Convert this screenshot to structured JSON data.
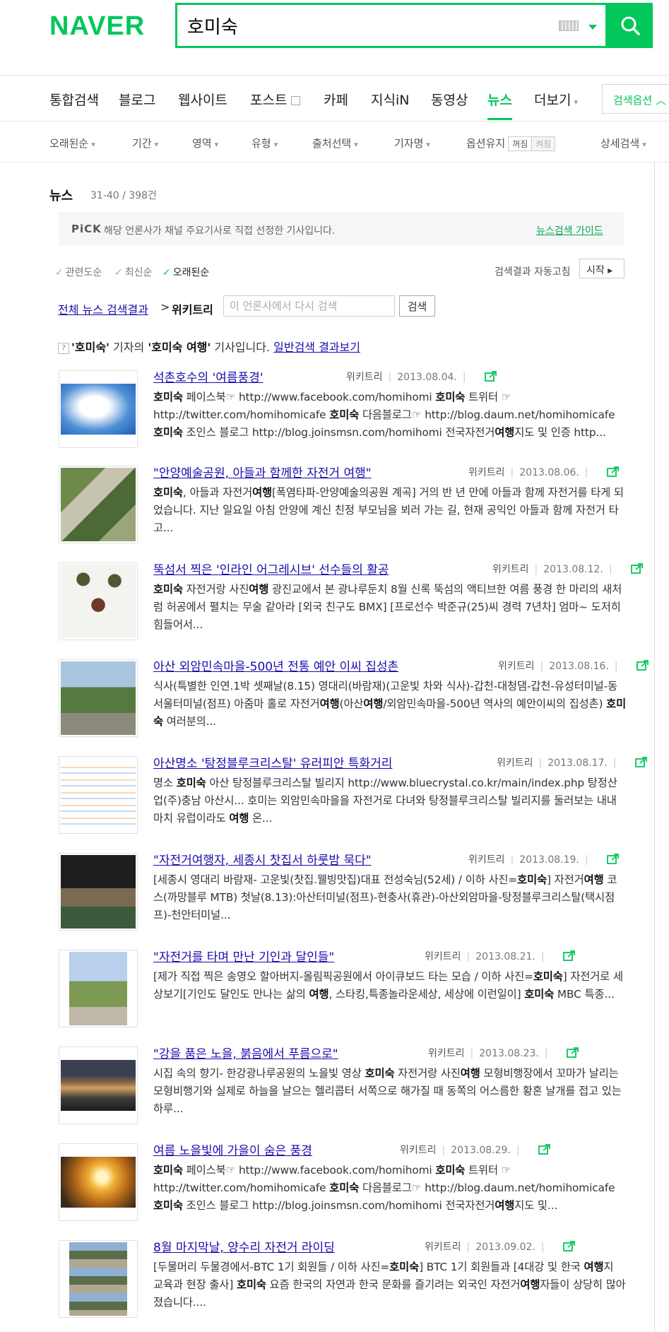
{
  "brand": {
    "logo": "NAVER",
    "color": "#03c75a"
  },
  "search": {
    "query": "호미숙",
    "button_icon": "search-icon",
    "keyboard_icon": "keyboard-icon"
  },
  "tabs": [
    {
      "label": "통합검색",
      "active": false
    },
    {
      "label": "블로그",
      "active": false
    },
    {
      "label": "웹사이트",
      "active": false
    },
    {
      "label": "포스트",
      "active": false
    },
    {
      "label": "카페",
      "active": false
    },
    {
      "label": "지식iN",
      "active": false
    },
    {
      "label": "동영상",
      "active": false
    },
    {
      "label": "뉴스",
      "active": true
    },
    {
      "label": "더보기",
      "active": false
    }
  ],
  "options_button": "검색옵션",
  "filters": {
    "items": [
      "오래된순",
      "기간",
      "영역",
      "유형",
      "출처선택",
      "기자명"
    ],
    "keep_label": "옵션유지",
    "keep_on": "꺼짐",
    "keep_off": "켜짐",
    "detail": "상세검색"
  },
  "section": {
    "title": "뉴스",
    "count": "31-40 / 398건"
  },
  "pick": {
    "label": "PiCK",
    "text": "해당 언론사가 채널 주요기사로 직접 선정한 기사입니다.",
    "link": "뉴스검색 가이드"
  },
  "sort": {
    "options": [
      "관련도순",
      "최신순",
      "오래된순"
    ],
    "selected": "오래된순",
    "auto_label": "검색결과 자동고침",
    "start": "시작"
  },
  "breadcrumb": {
    "all": "전체 뉴스 검색결과",
    "sep": ">",
    "current": "위키트리"
  },
  "research": {
    "placeholder": "이 언론사에서 다시 검색",
    "button": "검색"
  },
  "notice": {
    "reporter": "'호미숙'",
    "text1": " 기자의 ",
    "keyword": "'호미숙 여행'",
    "text2": " 기사입니다. ",
    "link": "일반검색 결과보기"
  },
  "results": [
    {
      "title": "석촌호수의 '여름풍경'",
      "source": "위키트리",
      "date": "2013.08.04.",
      "desc": [
        {
          "t": "호미숙",
          "b": true
        },
        {
          "t": " 페이스북☞ http://www.facebook.com/homihomi "
        },
        {
          "t": "호미숙",
          "b": true
        },
        {
          "t": " 트위터 ☞ http://twitter.com/homihomicafe "
        },
        {
          "t": "호미숙",
          "b": true
        },
        {
          "t": " 다음블로그☞ http://blog.daum.net/homihomicafe "
        },
        {
          "t": "호미숙",
          "b": true
        },
        {
          "t": " 조인스 블로그 http://blog.joinsmsn.com/homihomi 전국자전거"
        },
        {
          "t": "여행",
          "b": true
        },
        {
          "t": "지도 및 인증 http..."
        }
      ]
    },
    {
      "title": "\"안양예술공원, 아들과 함께한 자전거 여행\"",
      "source": "위키트리",
      "date": "2013.08.06.",
      "desc": [
        {
          "t": "호미숙",
          "b": true
        },
        {
          "t": ", 아들과 자전거"
        },
        {
          "t": "여행",
          "b": true
        },
        {
          "t": "[폭염타파-안양예술의공원 계곡] 거의 반 년 만에 아들과 함께 자전거를 타게 되었습니다. 지난 일요일 아침 안양에 계신 친정 부모님을 뵈러 가는 길, 현재 공익인 아들과 함께 자전거 타고..."
        }
      ]
    },
    {
      "title": "뚝섬서 찍은 '인라인 어그레시브' 선수들의 활공",
      "source": "위키트리",
      "date": "2013.08.12.",
      "desc": [
        {
          "t": "호미숙",
          "b": true
        },
        {
          "t": " 자전거랑 사진"
        },
        {
          "t": "여행",
          "b": true
        },
        {
          "t": " 광진교에서 본 광나루둔치 8월 신록 뚝섬의 액티브한 여름 풍경 한 마리의 새처럼 허공에서 펼치는 무술 같아라 [외국 친구도 BMX] [프로선수 박준규(25)씨 경력 7년차] 엄마~ 도저히 힘들어서..."
        }
      ]
    },
    {
      "title": "아산 외암민속마을-500년 전통 예안 이씨 집성촌",
      "source": "위키트리",
      "date": "2013.08.16.",
      "desc": [
        {
          "t": "식사(특별한 인연.1박 셋째날(8.15) 영대리(바람재)(고운빛 차와 식사)-갑천-대청댐-갑천-유성터미널-동서울터미널(점프) 아줌마 홀로 자전거"
        },
        {
          "t": "여행",
          "b": true
        },
        {
          "t": "(아산"
        },
        {
          "t": "여행",
          "b": true
        },
        {
          "t": "/외암민속마을-500년 역사의 예안이씨의 집성촌) "
        },
        {
          "t": "호미숙",
          "b": true
        },
        {
          "t": " 여러분의..."
        }
      ]
    },
    {
      "title": "아산명소 '탕정블루크리스탈' 유러피안 특화거리",
      "source": "위키트리",
      "date": "2013.08.17.",
      "desc": [
        {
          "t": "명소 "
        },
        {
          "t": "호미숙",
          "b": true
        },
        {
          "t": " 아산 탕정블루크리스탈 빌리지 http://www.bluecrystal.co.kr/main/index.php 탕정산업(주)충남 아산시... 호미는 외암민속마을을 자전거로 다녀와 탕정블루크리스탈 빌리지를 둘러보는 내내 마치 유럽이라도 "
        },
        {
          "t": "여행",
          "b": true
        },
        {
          "t": " 온..."
        }
      ]
    },
    {
      "title": "\"자전거여행자, 세종시 찻집서 하룻밤 묵다\"",
      "source": "위키트리",
      "date": "2013.08.19.",
      "desc": [
        {
          "t": "[세종시 영대리 바람재- 고운빛(찻집.웰빙맛집)대표 전성숙님(52세) / 이하 사진="
        },
        {
          "t": "호미숙",
          "b": true
        },
        {
          "t": "] 자전거"
        },
        {
          "t": "여행",
          "b": true
        },
        {
          "t": " 코스(까망블루 MTB) 첫날(8.13):아산터미널(점프)-현충사(휴관)-아산외암마을-탕정블루크리스탈(택시점프)-천안터미널..."
        }
      ]
    },
    {
      "title": "\"자전거를 타며 만난 기인과 달인들\"",
      "source": "위키트리",
      "date": "2013.08.21.",
      "desc": [
        {
          "t": "[제가 직접 찍은 송영오 할아버지-올림픽공원에서 아이큐보드 타는 모습 / 이하 사진="
        },
        {
          "t": "호미숙",
          "b": true
        },
        {
          "t": "] 자전거로 세상보기[기인도 달인도 만나는 삶의 "
        },
        {
          "t": "여행",
          "b": true
        },
        {
          "t": ", 스타킹,특종놀라운세상, 세상에 이런일이] "
        },
        {
          "t": "호미숙",
          "b": true
        },
        {
          "t": " MBC 특종..."
        }
      ]
    },
    {
      "title": "\"강을 품은 노을, 붉음에서 푸름으로\"",
      "source": "위키트리",
      "date": "2013.08.23.",
      "desc": [
        {
          "t": "시집 속의 향기- 한강광나루공원의 노을빛 영상 "
        },
        {
          "t": "호미숙",
          "b": true
        },
        {
          "t": " 자전거랑 사진"
        },
        {
          "t": "여행",
          "b": true
        },
        {
          "t": " 모형비행장에서 꼬마가 날리는 모형비행기와 실제로 하늘을 날으는 헬리콥터 서쪽으로 해가질 때 동쪽의 어스름한 황혼 날개를 접고 있는 하루..."
        }
      ]
    },
    {
      "title": "여름 노을빛에 가을이 숨은 풍경",
      "source": "위키트리",
      "date": "2013.08.29.",
      "desc": [
        {
          "t": "호미숙",
          "b": true
        },
        {
          "t": " 페이스북☞ http://www.facebook.com/homihomi "
        },
        {
          "t": "호미숙",
          "b": true
        },
        {
          "t": " 트위터 ☞ http://twitter.com/homihomicafe "
        },
        {
          "t": "호미숙",
          "b": true
        },
        {
          "t": " 다음블로그☞ http://blog.daum.net/homihomicafe "
        },
        {
          "t": "호미숙",
          "b": true
        },
        {
          "t": " 조인스 블로그 http://blog.joinsmsn.com/homihomi 전국자전거"
        },
        {
          "t": "여행",
          "b": true
        },
        {
          "t": "지도 및..."
        }
      ]
    },
    {
      "title": "8월 마지막날, 양수리 자전거 라이딩",
      "source": "위키트리",
      "date": "2013.09.02.",
      "desc": [
        {
          "t": "[두물머리 두물경에서-BTC 1기 회원들 / 이하 사진="
        },
        {
          "t": "호미숙",
          "b": true
        },
        {
          "t": "] BTC 1기 회원들과 [4대강 및 한국 "
        },
        {
          "t": "여행",
          "b": true
        },
        {
          "t": "지 교육과 현장 출사] "
        },
        {
          "t": "호미숙",
          "b": true
        },
        {
          "t": " 요즘 한국의 자연과 한국 문화를 즐기려는 외국인 자전거"
        },
        {
          "t": "여행",
          "b": true
        },
        {
          "t": "자들이 상당히 많아졌습니다...."
        }
      ]
    }
  ]
}
